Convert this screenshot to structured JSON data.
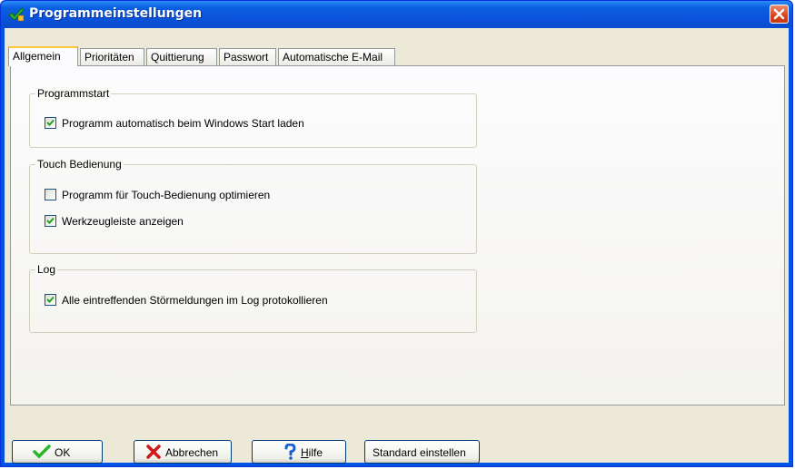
{
  "window": {
    "title": "Programmeinstellungen"
  },
  "tabs": [
    {
      "label": "Allgemein",
      "active": true
    },
    {
      "label": "Prioritäten",
      "active": false
    },
    {
      "label": "Quittierung",
      "active": false
    },
    {
      "label": "Passwort",
      "active": false
    },
    {
      "label": "Automatische E-Mail",
      "active": false
    }
  ],
  "groups": {
    "programmstart": {
      "title": "Programmstart",
      "options": [
        {
          "label": "Programm automatisch beim Windows Start laden",
          "checked": true
        }
      ]
    },
    "touch": {
      "title": "Touch Bedienung",
      "options": [
        {
          "label": "Programm für Touch-Bedienung optimieren",
          "checked": false
        },
        {
          "label": "Werkzeugleiste anzeigen",
          "checked": true
        }
      ]
    },
    "log": {
      "title": "Log",
      "options": [
        {
          "label": "Alle eintreffenden Störmeldungen im Log protokollieren",
          "checked": true
        }
      ]
    }
  },
  "buttons": {
    "ok": {
      "label": "OK",
      "icon": "checkmark-icon"
    },
    "cancel": {
      "label": "Abbrechen",
      "icon": "red-x-icon"
    },
    "help": {
      "label_accel": "H",
      "label_rest": "ilfe",
      "icon": "question-icon"
    },
    "default": {
      "label": "Standard einstellen"
    }
  },
  "colors": {
    "titlebar": "#0a54dc",
    "face": "#ece9d8",
    "check": "#21a121",
    "close": "#d9421a"
  }
}
